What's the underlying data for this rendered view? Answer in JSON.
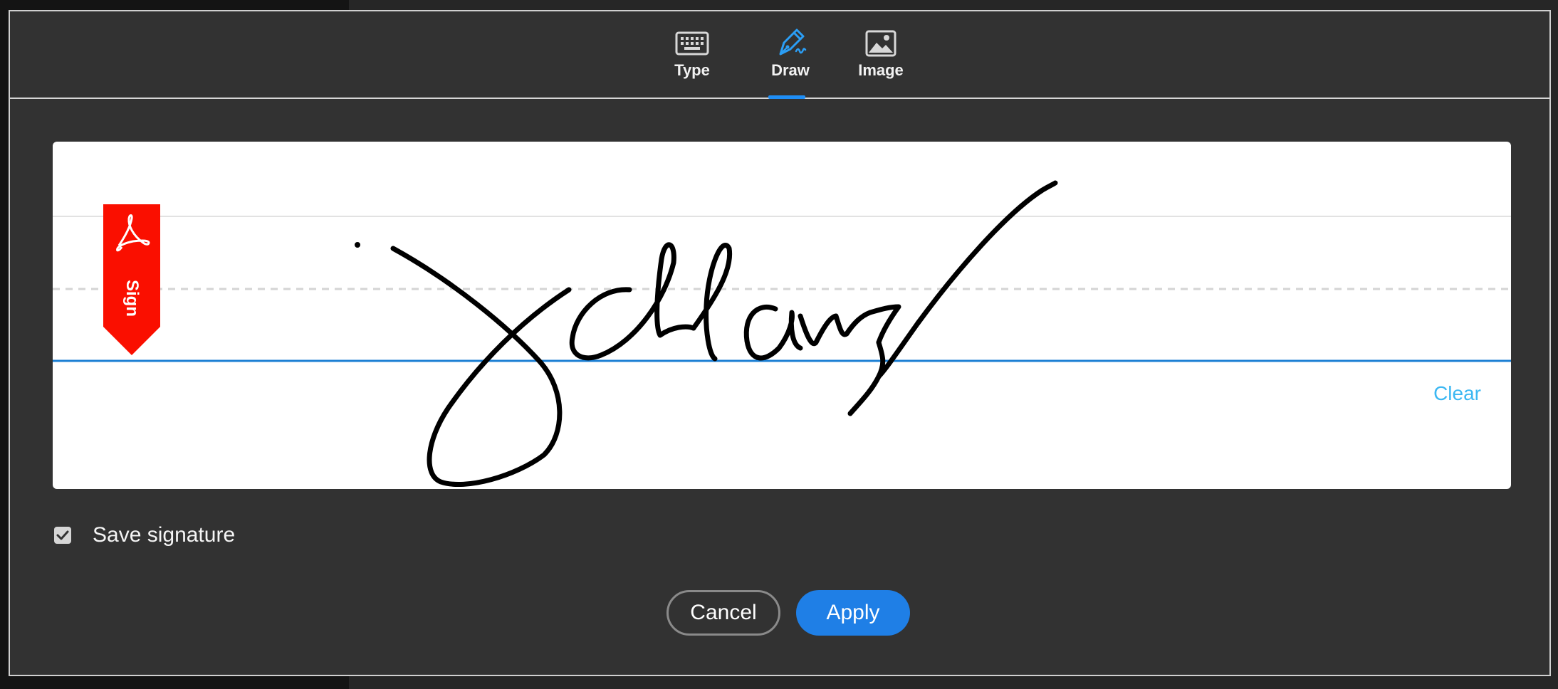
{
  "tabs": [
    {
      "label": "Type",
      "icon": "keyboard-icon",
      "active": false
    },
    {
      "label": "Draw",
      "icon": "pen-icon",
      "active": true
    },
    {
      "label": "Image",
      "icon": "image-icon",
      "active": false
    }
  ],
  "canvas": {
    "badge_text": "Sign",
    "clear_label": "Clear"
  },
  "save_signature": {
    "label": "Save signature",
    "checked": true
  },
  "buttons": {
    "cancel": "Cancel",
    "apply": "Apply"
  },
  "colors": {
    "accent": "#1f7fe6",
    "badge": "#fa0f00",
    "clear_link": "#3bb7f2",
    "baseline": "#1b7fd4"
  }
}
